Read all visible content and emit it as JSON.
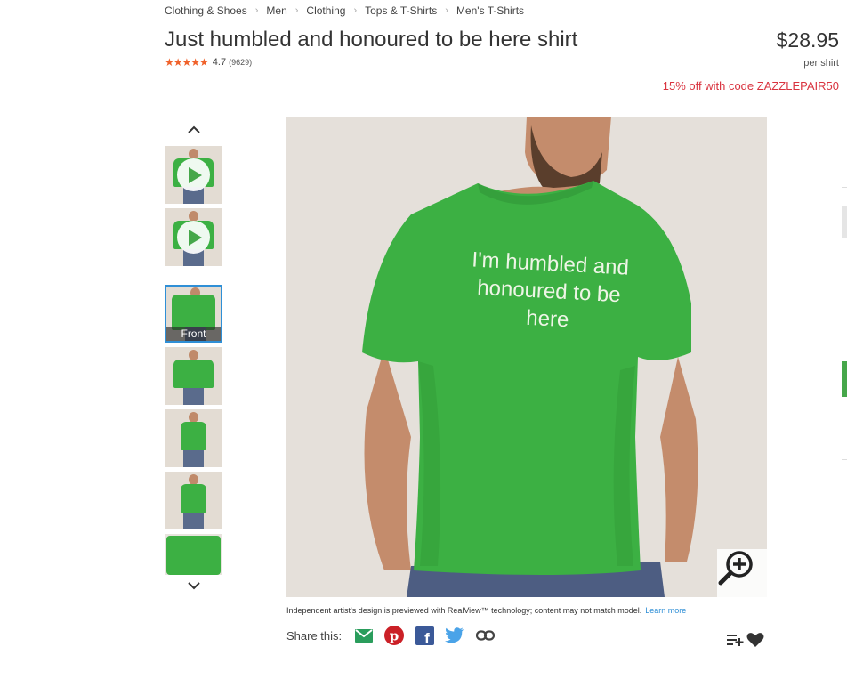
{
  "breadcrumb": [
    "Clothing & Shoes",
    "Men",
    "Clothing",
    "Tops & T-Shirts",
    "Men's T-Shirts"
  ],
  "product": {
    "title": "Just humbled and honoured to be here shirt",
    "rating": "4.7",
    "rating_count": "(9629)",
    "stars": "★★★★★",
    "price": "$28.95",
    "price_unit": "per shirt",
    "promo": "15% off with code ZAZZLEPAIR50"
  },
  "gallery": {
    "selected_caption": "Front",
    "shirt_text": "I'm humbled and\nhonoured to be\nhere"
  },
  "disclaimer": {
    "text": "Independent artist's design is previewed with RealView™ technology; content may not match model.",
    "link": "Learn more"
  },
  "share": {
    "label": "Share this:",
    "icons": [
      "email-icon",
      "pinterest-icon",
      "facebook-icon",
      "twitter-icon",
      "link-icon"
    ]
  },
  "colors": {
    "shirt_green": "#3cb043",
    "promo_red": "#d9333f",
    "star_orange": "#f0622b",
    "link_blue": "#2f8fd6"
  }
}
